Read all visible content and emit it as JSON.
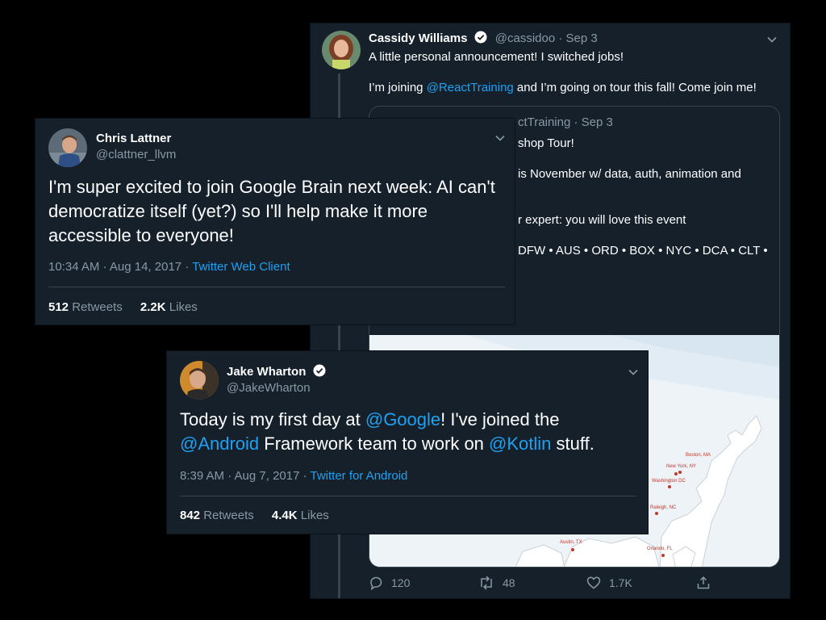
{
  "colors": {
    "background": "#000000",
    "card": "#15202b",
    "link": "#1da1f2",
    "muted": "#8899a6",
    "divider": "#38444d"
  },
  "cassidy": {
    "name": "Cassidy Williams",
    "handle": "@cassidoo",
    "date": "Sep 3",
    "text_line1": "A little personal announcement! I switched jobs!",
    "text_line2_prefix": "I’m joining ",
    "text_line2_mention": "@ReactTraining",
    "text_line2_suffix": " and I’m going on tour this fall! Come join me!",
    "quote": {
      "header_visible": "ctTraining · Sep 3",
      "line1": "shop Tour!",
      "line2": "is November w/ data, auth, animation and",
      "line3": "r expert: you will love this event",
      "line4": "DFW • AUS • ORD • BOX • NYC • DCA • CLT •"
    },
    "map_labels": {
      "boston": "Boston, MA",
      "newyork": "New York, NY",
      "washington": "Washington DC",
      "raleigh": "Raleigh, NC",
      "austin": "Austin, TX",
      "orlando": "Orlando, FL"
    },
    "actions": {
      "replies": "120",
      "retweets": "48",
      "likes": "1.7K"
    }
  },
  "chris": {
    "name": "Chris Lattner",
    "handle": "@clattner_llvm",
    "text": "I'm super excited to join Google Brain next week: AI can't democratize itself (yet?) so I'll help make it more accessible to everyone!",
    "time": "10:34 AM · Aug 14, 2017 · ",
    "client": "Twitter Web Client",
    "retweets_count": "512",
    "retweets_label": "Retweets",
    "likes_count": "2.2K",
    "likes_label": "Likes"
  },
  "jake": {
    "name": "Jake Wharton",
    "handle": "@JakeWharton",
    "text_part1": "Today is my first day at ",
    "mention_google": "@Google",
    "text_part2": "! I've joined the ",
    "mention_android": "@Android",
    "text_part3": " Framework team to work on ",
    "mention_kotlin": "@Kotlin",
    "text_part4": " stuff.",
    "time": "8:39 AM · Aug 7, 2017 · ",
    "client": "Twitter for Android",
    "retweets_count": "842",
    "retweets_label": "Retweets",
    "likes_count": "4.4K",
    "likes_label": "Likes"
  }
}
